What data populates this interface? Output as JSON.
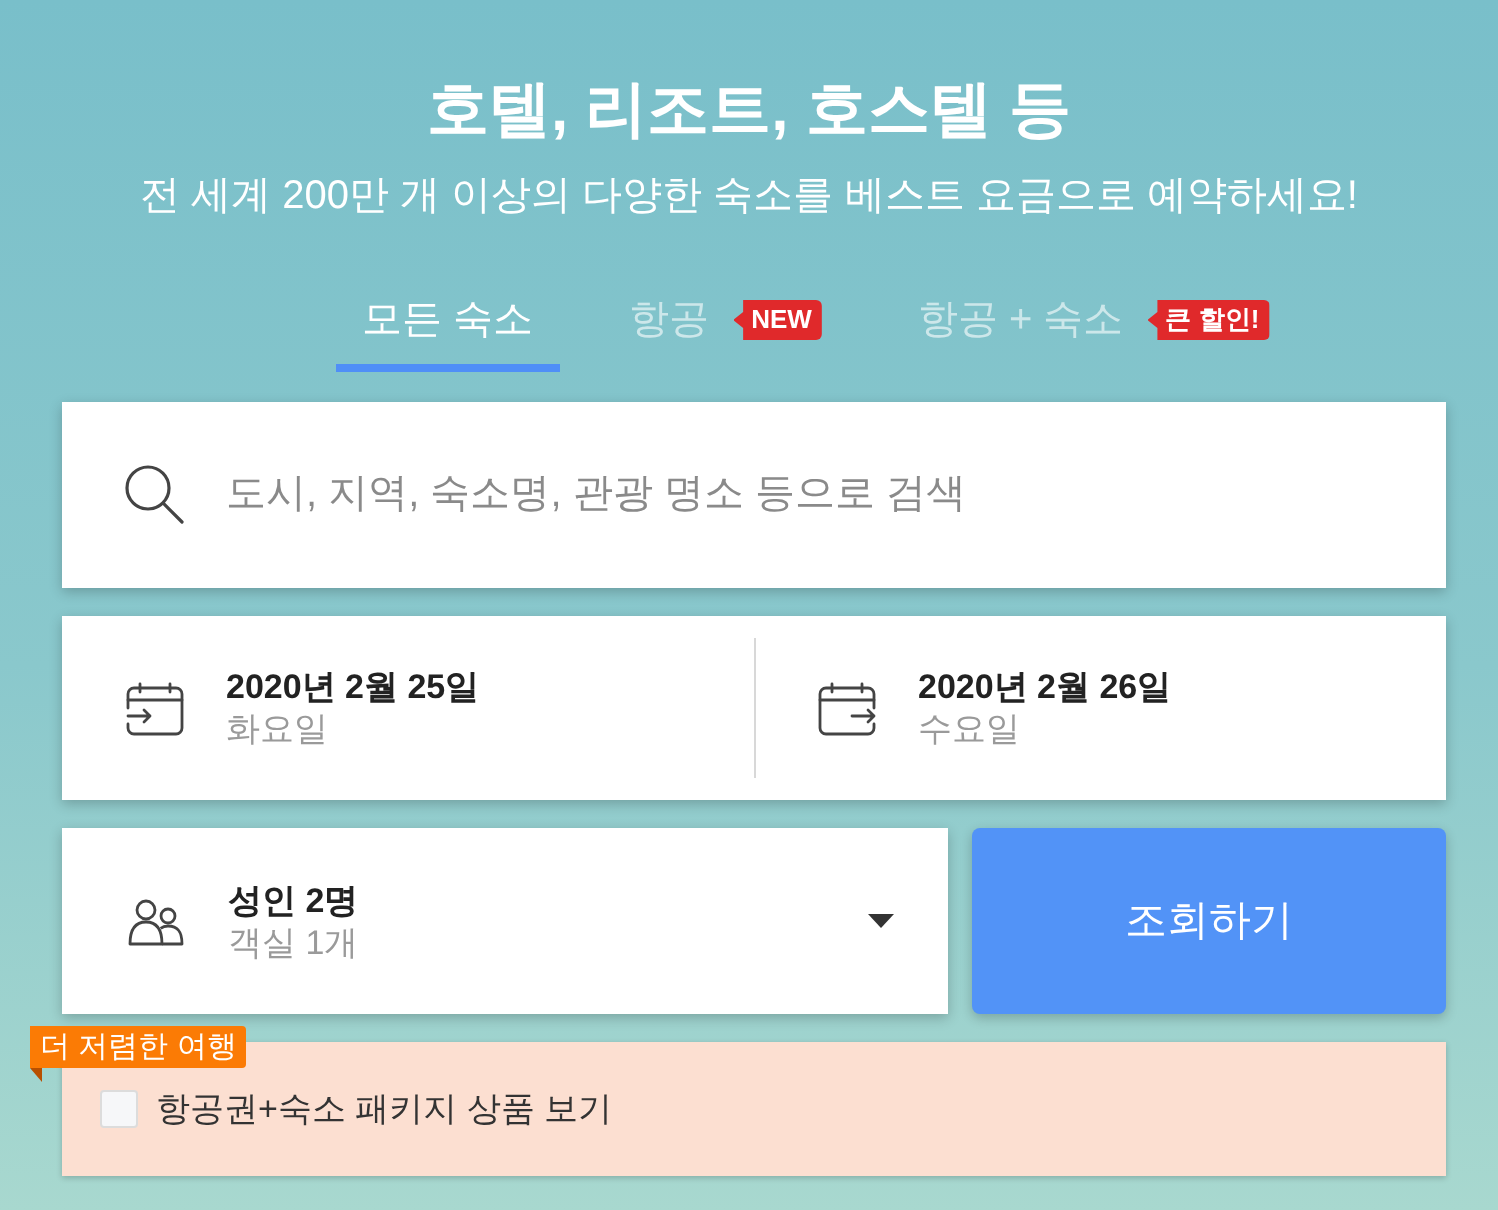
{
  "header": {
    "title": "호텔, 리조트, 호스텔 등",
    "subtitle": "전 세계 200만 개 이상의 다양한 숙소를 베스트 요금으로 예약하세요!"
  },
  "tabs": [
    {
      "label": "모든 숙소",
      "selected": true
    },
    {
      "label": "항공",
      "selected": false,
      "badge": "NEW"
    },
    {
      "label": "항공 + 숙소",
      "selected": false,
      "badge": "큰 할인!"
    }
  ],
  "search": {
    "placeholder": "도시, 지역, 숙소명, 관광 명소 등으로 검색"
  },
  "dates": [
    {
      "kind": "check_in",
      "date": "2020년 2월 25일",
      "weekday": "화요일"
    },
    {
      "kind": "check_out",
      "date": "2020년 2월 26일",
      "weekday": "수요일"
    }
  ],
  "occupancy": {
    "guests": "성인 2명",
    "rooms": "객실 1개"
  },
  "search_button": {
    "label": "조회하기"
  },
  "package_offer": {
    "badge": "더 저렴한 여행",
    "label": "항공권+숙소 패키지 상품 보기",
    "checked": false
  }
}
